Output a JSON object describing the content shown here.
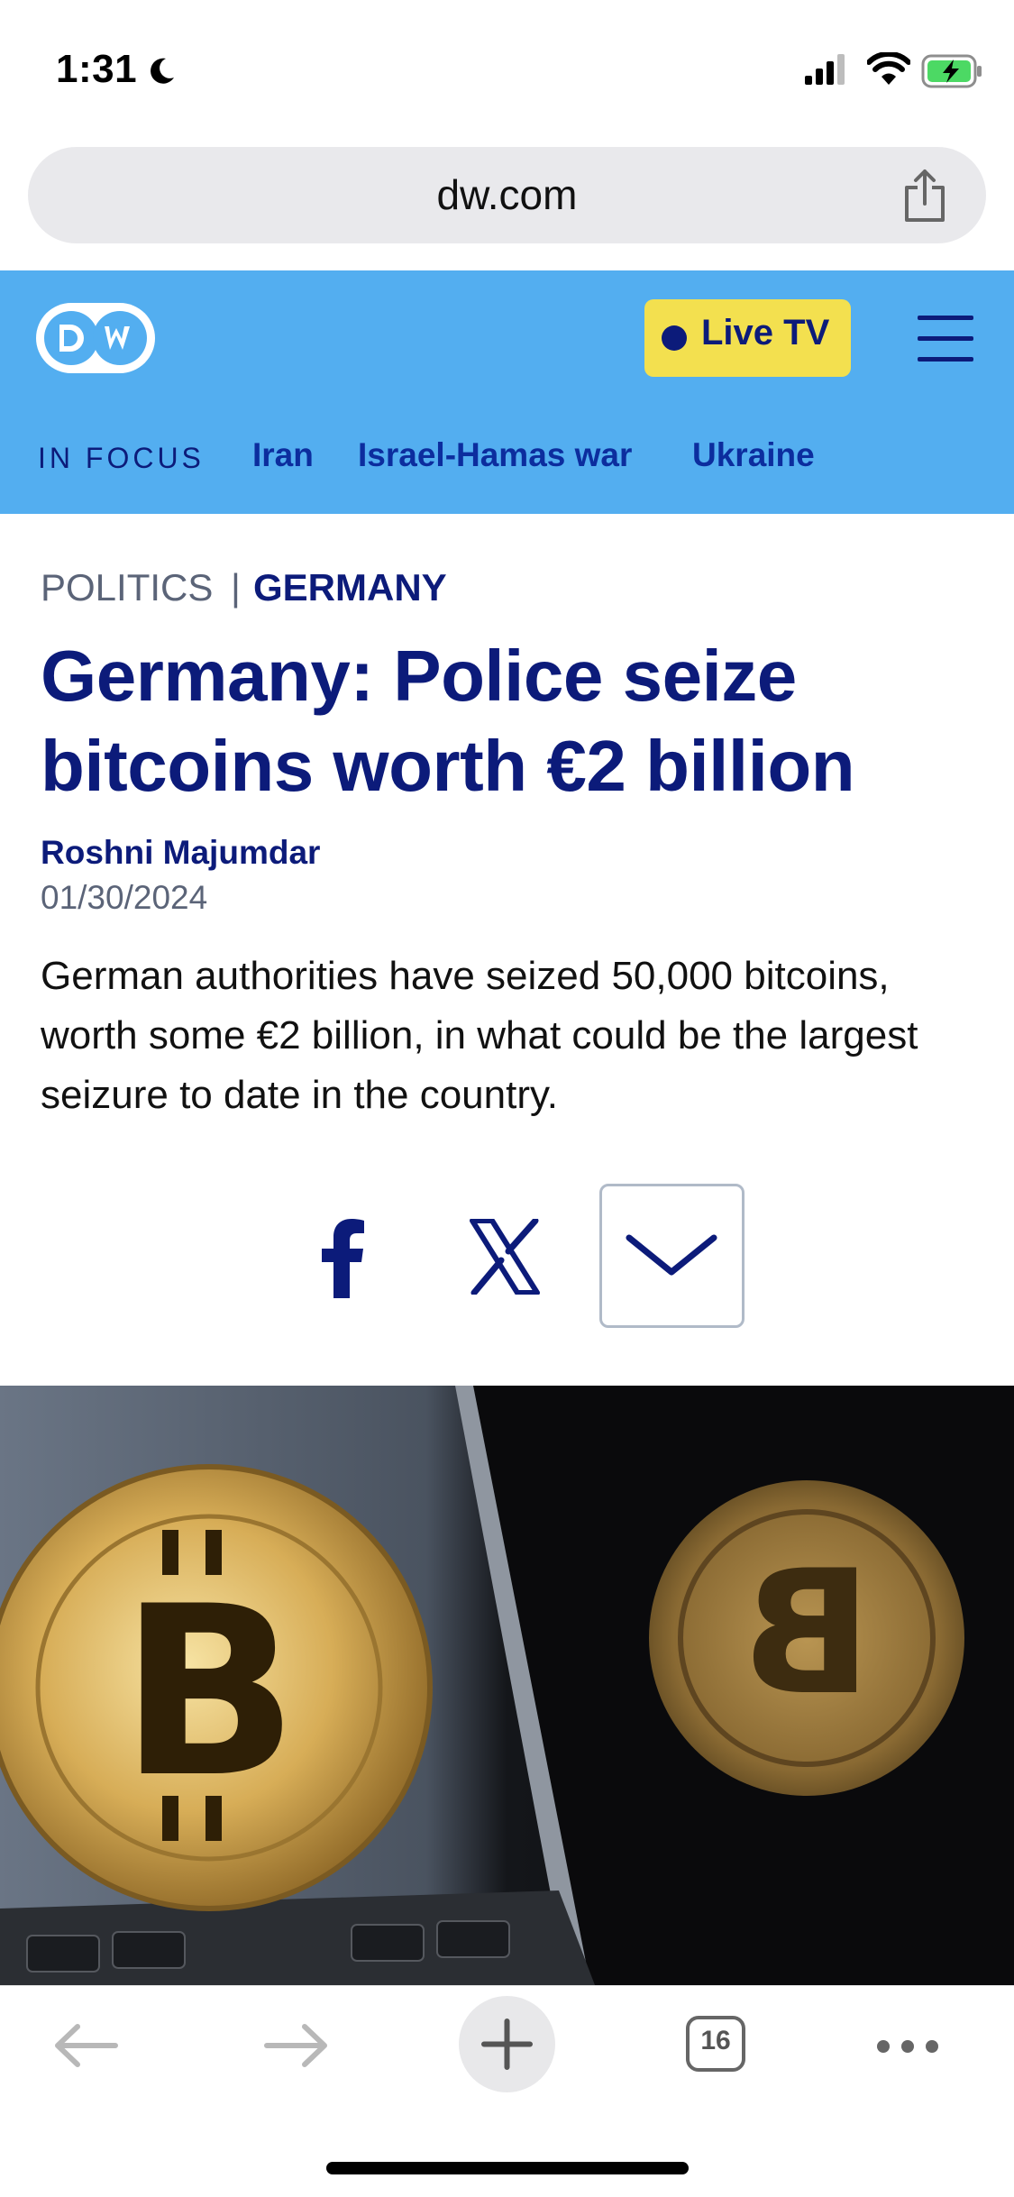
{
  "status_bar": {
    "time": "1:31",
    "icons": [
      "moon-icon",
      "cellular-signal-icon",
      "wifi-icon",
      "battery-charging-icon"
    ]
  },
  "browser": {
    "url": "dw.com",
    "share_icon": "share-icon",
    "toolbar": {
      "back_icon": "arrow-left-icon",
      "forward_icon": "arrow-right-icon",
      "new_tab_icon": "plus-icon",
      "tabs_count": "16",
      "more_icon": "ellipsis-icon"
    }
  },
  "site_header": {
    "logo": "DW",
    "live_tv_label": "Live TV",
    "menu_icon": "hamburger-menu-icon",
    "in_focus_label": "IN FOCUS",
    "focus_links": [
      "Iran",
      "Israel-Hamas war",
      "Ukraine"
    ]
  },
  "article": {
    "category": "POLITICS",
    "separator": "|",
    "region": "GERMANY",
    "headline": "Germany: Police seize bitcoins worth €2 billion",
    "author": "Roshni Majumdar",
    "date": "01/30/2024",
    "teaser": "German authorities have seized 50,000 bitcoins, worth some €2 billion, in what could be the largest seizure to date in the country.",
    "share": {
      "facebook_icon": "facebook-icon",
      "x_icon": "x-icon",
      "more_icon": "chevron-down-icon"
    }
  },
  "colors": {
    "dw_header_blue": "#53aef0",
    "dw_navy": "#0c1b7a",
    "live_tv_yellow": "#f3e04f",
    "meta_gray": "#5b6478"
  }
}
